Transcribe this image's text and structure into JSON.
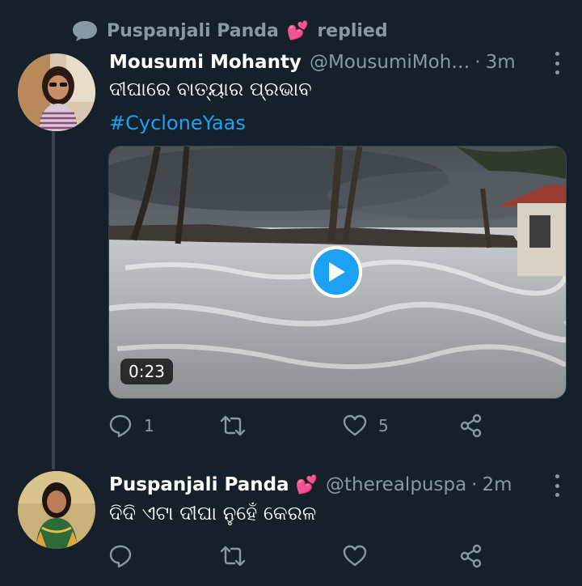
{
  "social_context": {
    "name": "Puspanjali Panda",
    "heart": "💕",
    "action": "replied"
  },
  "tweets": [
    {
      "name": "Mousumi Mohanty",
      "handle": "@MousumiMoh…",
      "separator": "·",
      "time": "3m",
      "text": "ଦୀଘାରେ ବାତ୍ୟାର ପ୍ରଭାବ",
      "hashtag": "#CycloneYaas",
      "video_duration": "0:23",
      "replies": "1",
      "retweets": "",
      "likes": "5"
    },
    {
      "name": "Puspanjali Panda",
      "name_emoji": "💕",
      "handle": "@therealpuspa",
      "separator": "·",
      "time": "2m",
      "text": "ଦିଦି ଏଟା ଦୀଘା ନୁହେଁ କେରଳ",
      "replies": "",
      "retweets": "",
      "likes": ""
    }
  ],
  "colors": {
    "background": "#15202b",
    "secondary_text": "#8899a6",
    "accent": "#1da1f2",
    "heart": "#e0245e"
  },
  "icons": [
    "reply-icon",
    "retweet-icon",
    "like-icon",
    "share-icon",
    "more-icon",
    "play-icon",
    "speech-bubble-icon"
  ]
}
